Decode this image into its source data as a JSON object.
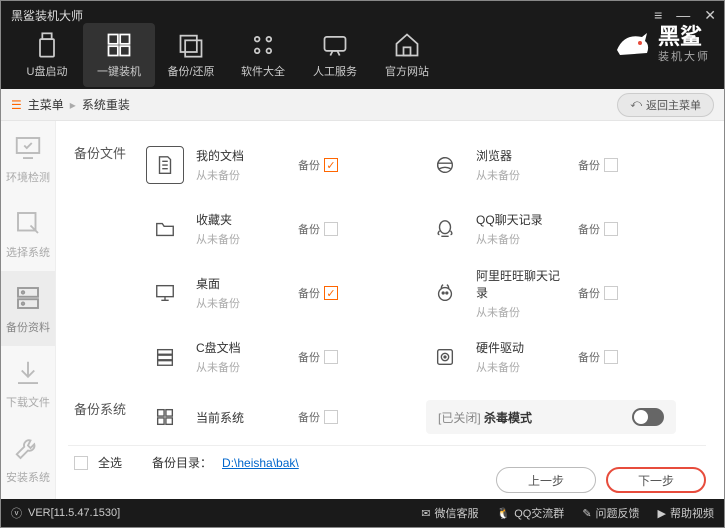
{
  "app_title": "黑鲨装机大师",
  "win": {
    "menu": "≡",
    "min": "—",
    "close": "✕"
  },
  "nav": [
    {
      "label": "U盘启动"
    },
    {
      "label": "一键装机"
    },
    {
      "label": "备份/还原"
    },
    {
      "label": "软件大全"
    },
    {
      "label": "人工服务"
    },
    {
      "label": "官方网站"
    }
  ],
  "logo": {
    "main": "黑鲨",
    "sub": "装机大师"
  },
  "breadcrumb": {
    "root": "主菜单",
    "current": "系统重装",
    "return": "返回主菜单"
  },
  "sidebar": [
    {
      "label": "环境检测"
    },
    {
      "label": "选择系统"
    },
    {
      "label": "备份资料"
    },
    {
      "label": "下载文件"
    },
    {
      "label": "安装系统"
    }
  ],
  "sections": {
    "files": "备份文件",
    "system": "备份系统"
  },
  "backup_label": "备份",
  "items": {
    "docs": {
      "title": "我的文档",
      "sub": "从未备份",
      "checked": true
    },
    "browser": {
      "title": "浏览器",
      "sub": "从未备份",
      "checked": false
    },
    "fav": {
      "title": "收藏夹",
      "sub": "从未备份",
      "checked": false
    },
    "qq": {
      "title": "QQ聊天记录",
      "sub": "从未备份",
      "checked": false
    },
    "desktop": {
      "title": "桌面",
      "sub": "从未备份",
      "checked": true
    },
    "aliww": {
      "title": "阿里旺旺聊天记录",
      "sub": "从未备份",
      "checked": false
    },
    "cdrive": {
      "title": "C盘文档",
      "sub": "从未备份",
      "checked": false
    },
    "hw": {
      "title": "硬件驱动",
      "sub": "从未备份",
      "checked": false
    },
    "os": {
      "title": "当前系统",
      "sub": "",
      "checked": false
    }
  },
  "kill_mode": {
    "prefix": "[已关闭]",
    "label": "杀毒模式"
  },
  "footer": {
    "select_all": "全选",
    "dir_label": "备份目录：",
    "dir_path": "D:\\heisha\\bak\\",
    "prev": "上一步",
    "next": "下一步"
  },
  "status": {
    "version": "VER[11.5.47.1530]",
    "wechat": "微信客服",
    "qqgroup": "QQ交流群",
    "feedback": "问题反馈",
    "help": "帮助视频"
  }
}
